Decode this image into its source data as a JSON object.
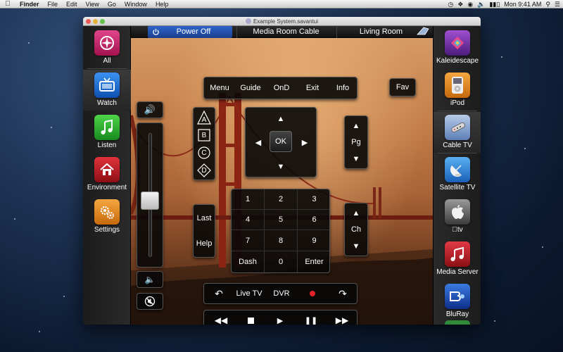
{
  "menubar": {
    "app": "Finder",
    "items": [
      "File",
      "Edit",
      "View",
      "Go",
      "Window",
      "Help"
    ],
    "clock": "Mon 9:41 AM"
  },
  "window": {
    "title": "Example System.savantui"
  },
  "zonebar": {
    "power": "Power Off",
    "source": "Media Room Cable",
    "room": "Living Room"
  },
  "left_sidebar": [
    {
      "label": "All",
      "icon": "compass-icon",
      "color": "#c0206a"
    },
    {
      "label": "Watch",
      "icon": "tv-icon",
      "color": "#1a6fd6"
    },
    {
      "label": "Listen",
      "icon": "music-note-icon",
      "color": "#2caa32"
    },
    {
      "label": "Environment",
      "icon": "house-icon",
      "color": "#c0202a"
    },
    {
      "label": "Settings",
      "icon": "gears-icon",
      "color": "#e88a18"
    }
  ],
  "right_sidebar": [
    {
      "label": "Kaleidescape",
      "icon": "kaleidescape-icon",
      "color": "#7a3aa8"
    },
    {
      "label": "iPod",
      "icon": "ipod-icon",
      "color": "#e88a18"
    },
    {
      "label": "Cable TV",
      "icon": "remote-icon",
      "color": "#6a8fc8"
    },
    {
      "label": "Satellite TV",
      "icon": "satellite-dish-icon",
      "color": "#1a6fd6"
    },
    {
      "label": "tv",
      "icon": "apple-tv-icon",
      "color": "#555555"
    },
    {
      "label": "Media Server",
      "icon": "media-server-icon",
      "color": "#c0202a"
    },
    {
      "label": "BluRay",
      "icon": "bluray-icon",
      "color": "#1a4fc0"
    }
  ],
  "menu_row": [
    "Menu",
    "Guide",
    "OnD",
    "Exit",
    "Info"
  ],
  "fav": "Fav",
  "abcd": [
    "A",
    "B",
    "C",
    "D"
  ],
  "dpad": {
    "ok": "OK"
  },
  "page": "Pg",
  "channel": "Ch",
  "keypad": [
    "1",
    "2",
    "3",
    "4",
    "5",
    "6",
    "7",
    "8",
    "9",
    "Dash",
    "0",
    "Enter"
  ],
  "last": "Last",
  "help": "Help",
  "transport_top": {
    "live": "Live TV",
    "dvr": "DVR"
  },
  "volume": {
    "level": 0.45
  },
  "colors": {
    "accent": "#1b3f8c",
    "record": "#e2222a"
  }
}
